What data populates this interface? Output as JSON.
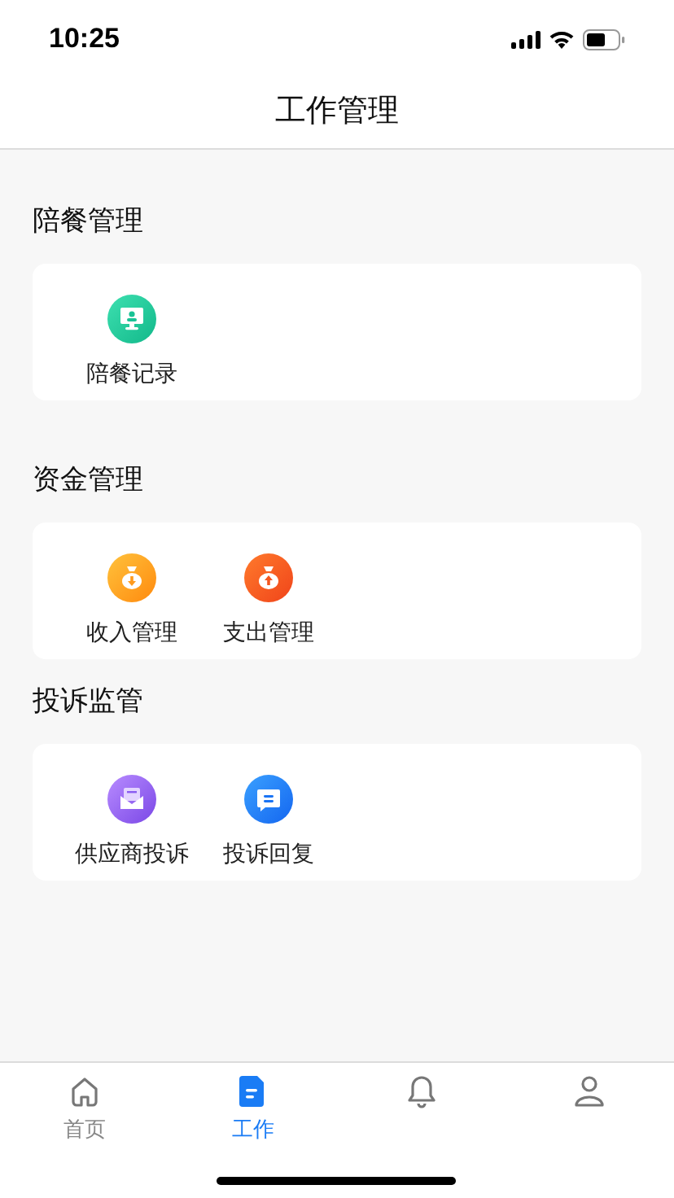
{
  "status_bar": {
    "time": "10:25"
  },
  "header": {
    "title": "工作管理"
  },
  "sections": [
    {
      "title": "陪餐管理",
      "items": [
        {
          "label": "陪餐记录",
          "kind": "monitor"
        }
      ]
    },
    {
      "title": "资金管理",
      "items": [
        {
          "label": "收入管理",
          "kind": "income"
        },
        {
          "label": "支出管理",
          "kind": "expense"
        }
      ]
    },
    {
      "title": "投诉监管",
      "items": [
        {
          "label": "供应商投诉",
          "kind": "mail"
        },
        {
          "label": "投诉回复",
          "kind": "chat"
        }
      ]
    }
  ],
  "tab_bar": [
    {
      "label": "首页",
      "kind": "home",
      "selected": false
    },
    {
      "label": "工作",
      "kind": "work",
      "selected": true
    },
    {
      "kind": "bell",
      "selected": false
    },
    {
      "kind": "person",
      "selected": false
    }
  ]
}
